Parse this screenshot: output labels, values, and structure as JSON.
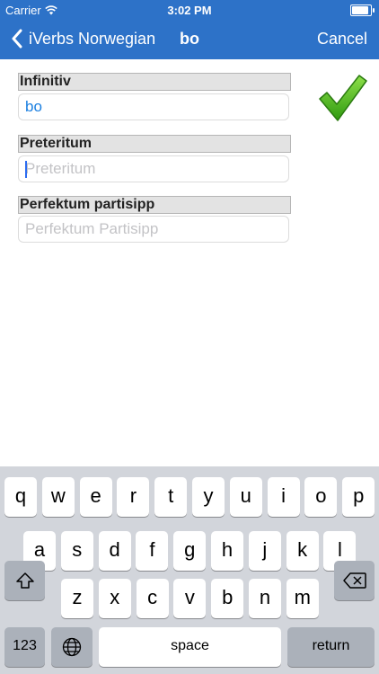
{
  "status_bar": {
    "carrier": "Carrier",
    "time": "3:02 PM"
  },
  "nav": {
    "back_label": "iVerbs Norwegian",
    "title": "bo",
    "cancel_label": "Cancel"
  },
  "form": {
    "infinitive": {
      "label": "Infinitiv",
      "value": "bo"
    },
    "preterite": {
      "label": "Preteritum",
      "placeholder": "Preteritum"
    },
    "perfect_participle": {
      "label": "Perfektum partisipp",
      "placeholder": "Perfektum Partisipp"
    }
  },
  "confirm_icon": "checkmark-icon",
  "keyboard": {
    "row1": [
      "q",
      "w",
      "e",
      "r",
      "t",
      "y",
      "u",
      "i",
      "o",
      "p"
    ],
    "row2": [
      "a",
      "s",
      "d",
      "f",
      "g",
      "h",
      "j",
      "k",
      "l"
    ],
    "row3": [
      "z",
      "x",
      "c",
      "v",
      "b",
      "n",
      "m"
    ],
    "numbers_label": "123",
    "space_label": "space",
    "return_label": "return"
  }
}
